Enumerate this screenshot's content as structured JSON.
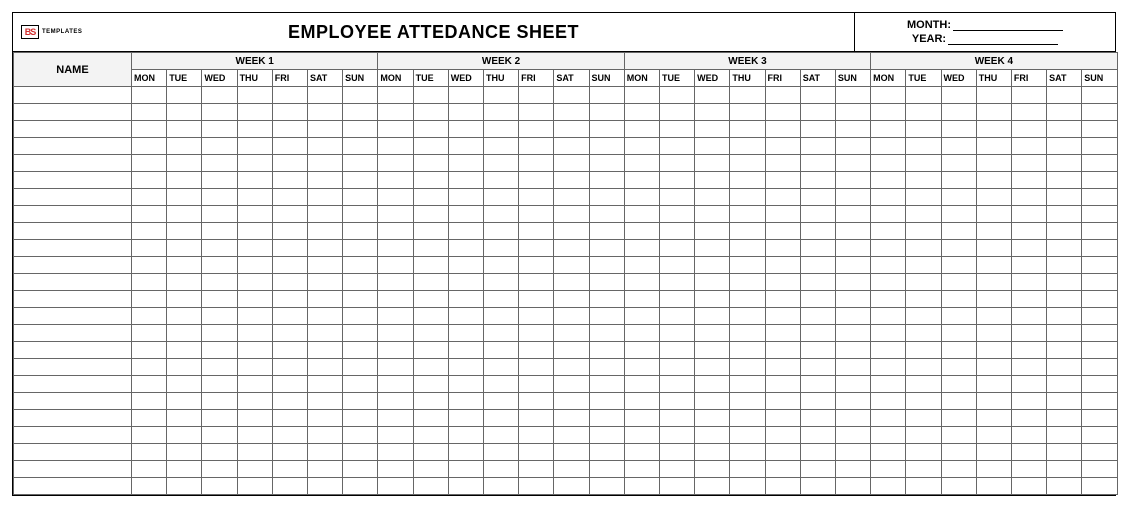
{
  "logo": {
    "icon_text": "BS",
    "label": "TEMPLATES"
  },
  "title": "EMPLOYEE ATTEDANCE SHEET",
  "month_label": "MONTH:",
  "year_label": "YEAR:",
  "name_header": "NAME",
  "weeks": [
    "WEEK 1",
    "WEEK 2",
    "WEEK 3",
    "WEEK 4"
  ],
  "days": [
    "MON",
    "TUE",
    "WED",
    "THU",
    "FRI",
    "SAT",
    "SUN"
  ],
  "row_count": 24
}
